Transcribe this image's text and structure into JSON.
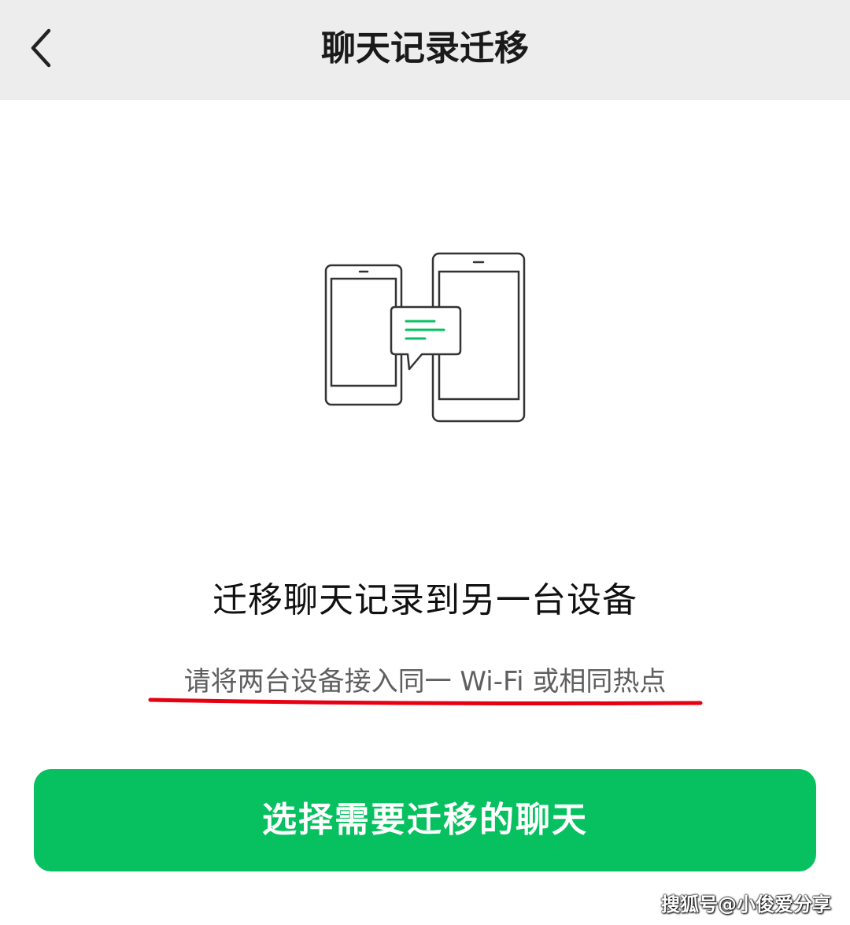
{
  "header": {
    "title": "聊天记录迁移",
    "back_icon": "chevron-left-icon"
  },
  "illustration": {
    "icon": "phones-transfer-icon",
    "accent_color": "#07c160"
  },
  "main": {
    "heading": "迁移聊天记录到另一台设备",
    "hint": "请将两台设备接入同一 Wi-Fi 或相同热点",
    "hint_underline_color": "#e60012"
  },
  "actions": {
    "primary_label": "选择需要迁移的聊天",
    "primary_color": "#07c160"
  },
  "watermark": {
    "text": "搜狐号@小俊爱分享"
  }
}
